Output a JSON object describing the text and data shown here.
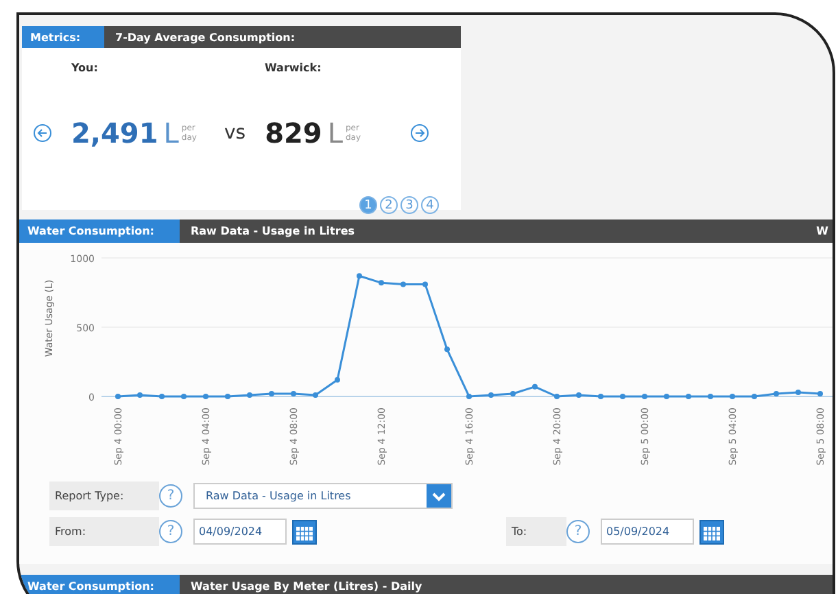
{
  "metrics": {
    "label": "Metrics:",
    "title": "7-Day Average Consumption:",
    "vs": "vs",
    "columns": [
      {
        "kind": "self",
        "heading": "You:",
        "value": "2,491",
        "unit": "L",
        "unit_top": "per",
        "unit_bottom": "day"
      },
      {
        "kind": "area",
        "heading": "Warwick:",
        "value": "829",
        "unit": "L",
        "unit_top": "per",
        "unit_bottom": "day"
      }
    ],
    "pages": [
      {
        "label": "1",
        "selected": true
      },
      {
        "label": "2",
        "selected": false
      },
      {
        "label": "3",
        "selected": false
      },
      {
        "label": "4",
        "selected": false
      }
    ]
  },
  "consumption": {
    "label": "Water Consumption:",
    "title": "Raw Data - Usage in Litres",
    "cut_title": "W",
    "chart_data": {
      "type": "line",
      "ylabel": "Water Usage (L)",
      "categories": [
        "Sep 4 00:00",
        null,
        null,
        null,
        "Sep 4 04:00",
        null,
        null,
        null,
        "Sep 4 08:00",
        null,
        null,
        null,
        "Sep 4 12:00",
        null,
        null,
        null,
        "Sep 4 16:00",
        null,
        null,
        null,
        "Sep 4 20:00",
        null,
        null,
        null,
        "Sep 5 00:00",
        null,
        null,
        null,
        "Sep 5 04:00",
        null,
        null,
        null,
        "Sep 5 08:00"
      ],
      "series": [
        {
          "color": "#3a8fd8",
          "marker": "circle",
          "values": [
            0,
            10,
            0,
            0,
            0,
            0,
            10,
            20,
            20,
            10,
            120,
            870,
            820,
            810,
            810,
            340,
            0,
            10,
            20,
            70,
            0,
            10,
            0,
            0,
            0,
            0,
            0,
            0,
            0,
            0,
            20,
            30,
            20
          ]
        }
      ],
      "ylim": [
        0,
        1000
      ],
      "yticks": [
        0,
        500,
        1000
      ]
    },
    "report_type": {
      "label": "Report Type:",
      "help": "?",
      "value": "Raw Data - Usage in Litres"
    },
    "from": {
      "label": "From:",
      "help": "?",
      "value": "04/09/2024"
    },
    "to": {
      "label": "To:",
      "help": "?",
      "value": "05/09/2024"
    }
  },
  "meter_section": {
    "label": "Water Consumption:",
    "title": "Water Usage By Meter (Litres) - Daily"
  }
}
